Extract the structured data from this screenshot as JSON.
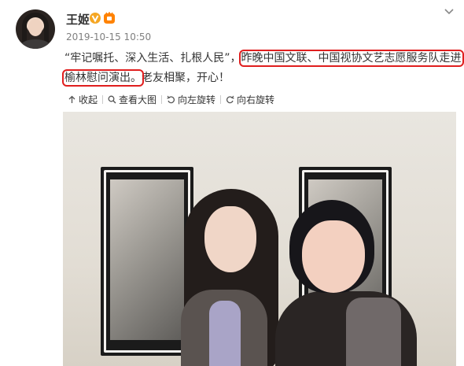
{
  "post": {
    "author": "王姬",
    "timestamp": "2019-10-15 10:50",
    "text_line1_a": "“牢记嘱托、深入生活、扎根人民”，",
    "text_line1_highlight": "昨晚中国文联、中国视协文艺志愿服务队走进",
    "text_line2_highlight": "榆林慰问演出。",
    "text_line2_b": "老友相聚，开心！"
  },
  "toolbar": {
    "collapse_label": "收起",
    "view_large_label": "查看大图",
    "rotate_left_label": "向左旋转",
    "rotate_right_label": "向右旋转"
  },
  "icons": {
    "verified": "verified-badge-icon",
    "level": "level-badge-icon",
    "menu": "chevron-down-icon",
    "collapse": "arrow-up-icon",
    "zoom": "magnifier-icon",
    "rotate_left": "rotate-left-icon",
    "rotate_right": "rotate-right-icon"
  },
  "colors": {
    "highlight_box": "#e01e1e",
    "verified_badge": "#f5a623",
    "timestamp": "#808080"
  }
}
